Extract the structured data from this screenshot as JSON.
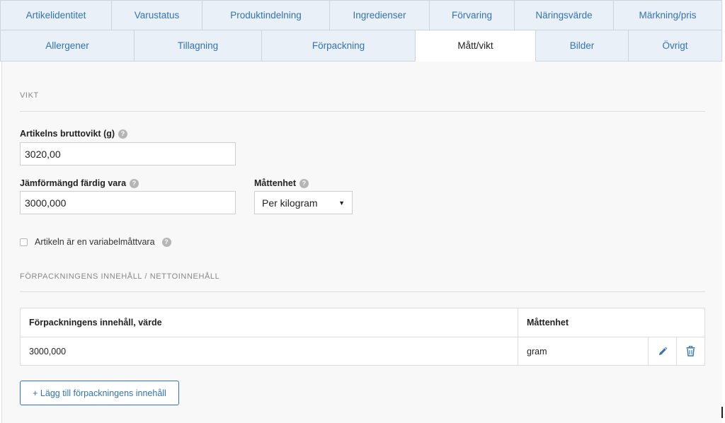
{
  "tabs_row1": [
    {
      "label": "Artikelidentitet"
    },
    {
      "label": "Varustatus"
    },
    {
      "label": "Produktindelning"
    },
    {
      "label": "Ingredienser"
    },
    {
      "label": "Förvaring"
    },
    {
      "label": "Näringsvärde"
    },
    {
      "label": "Märkning/pris"
    }
  ],
  "tabs_row2": [
    {
      "label": "Allergener"
    },
    {
      "label": "Tillagning"
    },
    {
      "label": "Förpackning"
    },
    {
      "label": "Mått/vikt"
    },
    {
      "label": "Bilder"
    },
    {
      "label": "Övrigt"
    }
  ],
  "active_tab": "Mått/vikt",
  "weight": {
    "section_title": "VIKT",
    "gross_weight_label": "Artikelns bruttovikt (g)",
    "gross_weight_value": "3020,00",
    "comparison_label": "Jämförmängd färdig vara",
    "comparison_value": "3000,000",
    "unit_label": "Måttenhet",
    "unit_selected": "Per kilogram",
    "variable_measure_label": "Artikeln är en variabelmåttvara",
    "variable_measure_checked": false
  },
  "net_content": {
    "section_title": "FÖRPACKNINGENS INNEHÅLL / NETTOINNEHÅLL",
    "columns": [
      "Förpackningens innehåll, värde",
      "Måttenhet"
    ],
    "rows": [
      {
        "value": "3000,000",
        "unit": "gram"
      }
    ],
    "add_button_label": "+ Lägg till förpackningens innehåll"
  },
  "icons": {
    "help": "question-circle-icon",
    "edit": "pencil-icon",
    "delete": "trash-icon",
    "dropdown": "caret-down-icon"
  },
  "colors": {
    "accent": "#3373b5",
    "tab_bg": "#e9f0f7",
    "panel_bg": "#f8f8f8"
  }
}
